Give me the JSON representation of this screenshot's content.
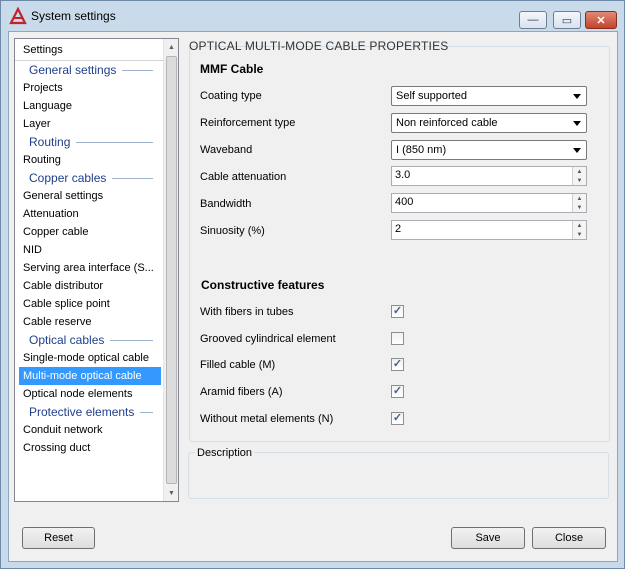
{
  "window": {
    "title": "System settings",
    "minimize_glyph": "—",
    "maximize_glyph": "▭",
    "close_glyph": "✕"
  },
  "sidebar": {
    "header": "Settings",
    "rows": [
      {
        "kind": "group",
        "label": "General settings"
      },
      {
        "kind": "item",
        "label": "Projects"
      },
      {
        "kind": "item",
        "label": "Language"
      },
      {
        "kind": "item",
        "label": "Layer"
      },
      {
        "kind": "group",
        "label": "Routing"
      },
      {
        "kind": "item",
        "label": "Routing"
      },
      {
        "kind": "group",
        "label": "Copper cables"
      },
      {
        "kind": "item",
        "label": "General settings"
      },
      {
        "kind": "item",
        "label": "Attenuation"
      },
      {
        "kind": "item",
        "label": "Copper cable"
      },
      {
        "kind": "item",
        "label": "NID"
      },
      {
        "kind": "item",
        "label": "Serving area interface (S..."
      },
      {
        "kind": "item",
        "label": "Cable distributor"
      },
      {
        "kind": "item",
        "label": "Cable splice point"
      },
      {
        "kind": "item",
        "label": "Cable reserve"
      },
      {
        "kind": "group",
        "label": "Optical cables"
      },
      {
        "kind": "item",
        "label": "Single-mode optical cable"
      },
      {
        "kind": "item",
        "label": "Multi-mode optical cable",
        "selected": true
      },
      {
        "kind": "item",
        "label": "Optical node elements"
      },
      {
        "kind": "group",
        "label": "Protective elements"
      },
      {
        "kind": "item",
        "label": "Conduit network"
      },
      {
        "kind": "item",
        "label": "Crossing duct"
      }
    ]
  },
  "panel": {
    "title": "OPTICAL MULTI-MODE CABLE PROPERTIES",
    "mmf_section": "MMF Cable",
    "coating_type": {
      "label": "Coating type",
      "value": "Self supported"
    },
    "reinforcement_type": {
      "label": "Reinforcement type",
      "value": "Non reinforced cable"
    },
    "waveband": {
      "label": "Waveband",
      "value": "I (850 nm)"
    },
    "cable_attenuation": {
      "label": "Cable attenuation",
      "value": "3.0"
    },
    "bandwidth": {
      "label": "Bandwidth",
      "value": "400"
    },
    "sinuosity": {
      "label": "Sinuosity (%)",
      "value": "2"
    },
    "constructive_section": "Constructive features",
    "features": [
      {
        "label": "With fibers in tubes",
        "checked": true
      },
      {
        "label": "Grooved cylindrical element",
        "checked": false
      },
      {
        "label": "Filled cable (M)",
        "checked": true
      },
      {
        "label": "Aramid fibers (A)",
        "checked": true
      },
      {
        "label": "Without metal elements (N)",
        "checked": true
      }
    ],
    "description_label": "Description"
  },
  "footer": {
    "reset_label": "Reset",
    "save_label": "Save",
    "close_label": "Close"
  },
  "colors": {
    "accent": "#3399ff",
    "group_header": "#1e3f8c",
    "title_bar": "#c9daea"
  }
}
